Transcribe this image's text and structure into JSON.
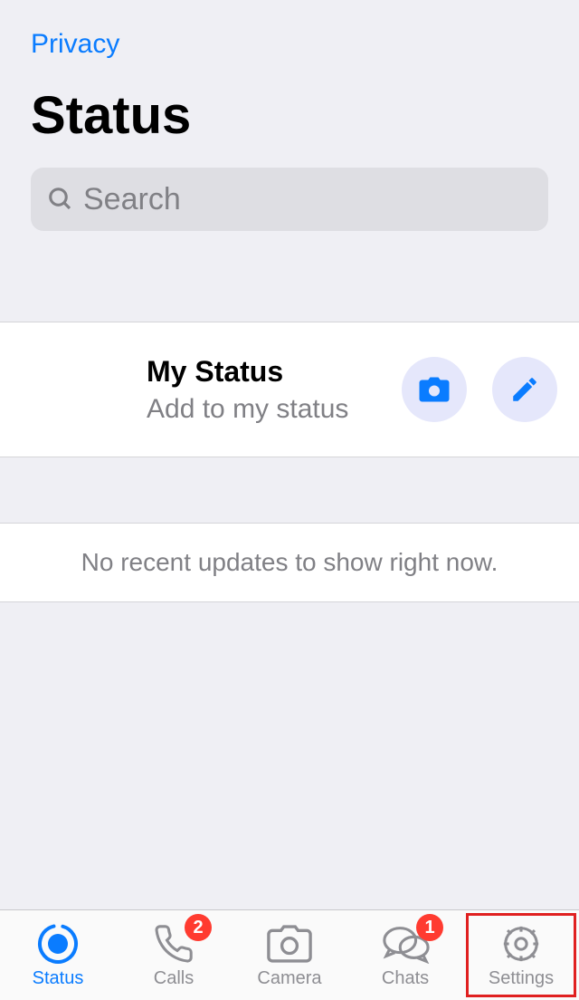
{
  "header": {
    "privacy": "Privacy",
    "title": "Status"
  },
  "search": {
    "placeholder": "Search"
  },
  "myStatus": {
    "title": "My Status",
    "subtitle": "Add to my status"
  },
  "empty": {
    "message": "No recent updates to show right now."
  },
  "tabs": {
    "status": {
      "label": "Status"
    },
    "calls": {
      "label": "Calls",
      "badge": "2"
    },
    "camera": {
      "label": "Camera"
    },
    "chats": {
      "label": "Chats",
      "badge": "1"
    },
    "settings": {
      "label": "Settings"
    }
  }
}
